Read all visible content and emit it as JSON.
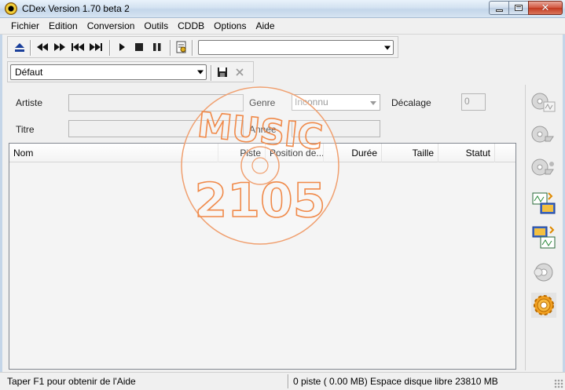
{
  "window": {
    "title": "CDex Version 1.70 beta 2",
    "close_glyph": "✕"
  },
  "menu": [
    "Fichier",
    "Edition",
    "Conversion",
    "Outils",
    "CDDB",
    "Options",
    "Aide"
  ],
  "toolbar": {
    "icons": [
      "eject-icon",
      "rewind-icon",
      "fast-forward-icon",
      "previous-track-icon",
      "next-track-icon",
      "play-icon",
      "stop-icon",
      "pause-icon",
      "edit-info-icon"
    ],
    "drive_select_value": ""
  },
  "profile": {
    "value": "Défaut",
    "save_icon": "save-icon",
    "delete_icon": "delete-icon"
  },
  "form": {
    "artist_label": "Artiste",
    "genre_label": "Genre",
    "genre_value": "Inconnu",
    "offset_label": "Décalage",
    "offset_value": "0",
    "title_label": "Titre",
    "year_label": "Année"
  },
  "table": {
    "columns": [
      "Nom",
      "Piste",
      "Position de...",
      "Durée",
      "Taille",
      "Statut"
    ],
    "rows": []
  },
  "right_panel": {
    "buttons": [
      "rip-to-wav-icon",
      "rip-to-compressed-icon",
      "rip-partial-icon",
      "convert-wav-to-compressed-icon",
      "convert-compressed-to-wav-icon",
      "record-icon",
      "settings-icon"
    ]
  },
  "watermark": {
    "line1": "MUSIC",
    "line2": "2105"
  },
  "status": {
    "help": "Taper F1 pour obtenir de l'Aide",
    "info": "0 piste ( 0.00 MB) Espace disque libre 23810 MB"
  }
}
